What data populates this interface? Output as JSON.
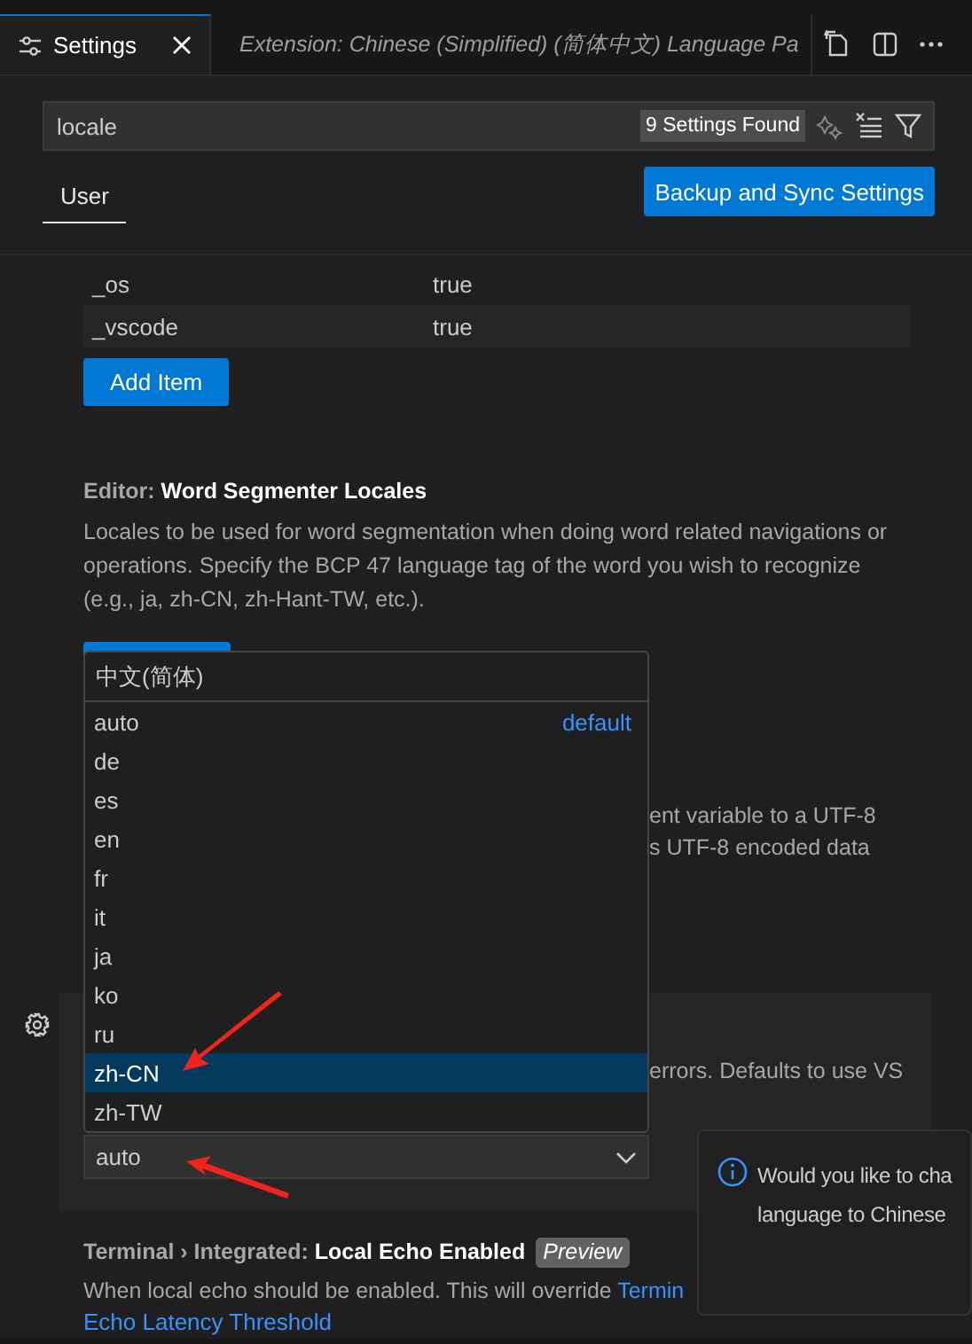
{
  "tabs": [
    {
      "label": "Settings",
      "kind": "settings",
      "selected": true,
      "closable": true
    },
    {
      "label": "Extension: Chinese (Simplified) (简体中文) Language Pa",
      "kind": "extension",
      "selected": false
    }
  ],
  "search": {
    "value": "locale",
    "count": "9 Settings Found"
  },
  "scope_tabs": [
    {
      "label": "User",
      "selected": true
    }
  ],
  "sync_button": "Backup and Sync Settings",
  "table": {
    "rows": [
      {
        "key": "_os",
        "value": "true"
      },
      {
        "key": "_vscode",
        "value": "true"
      }
    ]
  },
  "add_item_button": "Add Item",
  "word_segmenter": {
    "category": "Editor: ",
    "title": "Word Segmenter Locales",
    "description": "Locales to be used for word segmentation when doing word related navigations or operations. Specify the BCP 47 language tag of the word you wish to recognize (e.g., ja, zh-CN, zh-Hant-TW, etc.)."
  },
  "hidden_setting": {
    "lines": [
      "ent variable to a UTF-8",
      "s UTF-8 encoded data"
    ]
  },
  "locale_setting": {
    "line": "errors. Defaults to use VS",
    "select_value": "auto"
  },
  "dropdown": {
    "header": "中文(简体)",
    "options": [
      {
        "label": "auto",
        "note": "default",
        "selected": false
      },
      {
        "label": "de",
        "selected": false
      },
      {
        "label": "es",
        "selected": false
      },
      {
        "label": "en",
        "selected": false
      },
      {
        "label": "fr",
        "selected": false
      },
      {
        "label": "it",
        "selected": false
      },
      {
        "label": "ja",
        "selected": false
      },
      {
        "label": "ko",
        "selected": false
      },
      {
        "label": "ru",
        "selected": false
      },
      {
        "label": "zh-CN",
        "selected": true
      },
      {
        "label": "zh-TW",
        "selected": false
      }
    ]
  },
  "terminal_setting": {
    "category": "Terminal › Integrated: ",
    "title": "Local Echo Enabled",
    "badge": "Preview",
    "text": "When local echo should be enabled. This will override ",
    "link": "Termin",
    "link_2": "Echo Latency Threshold"
  },
  "notification": {
    "lines": [
      "Would you like to cha",
      "language to Chinese"
    ]
  },
  "annotations": [
    {
      "kind": "arrow"
    },
    {
      "kind": "arrow"
    }
  ]
}
